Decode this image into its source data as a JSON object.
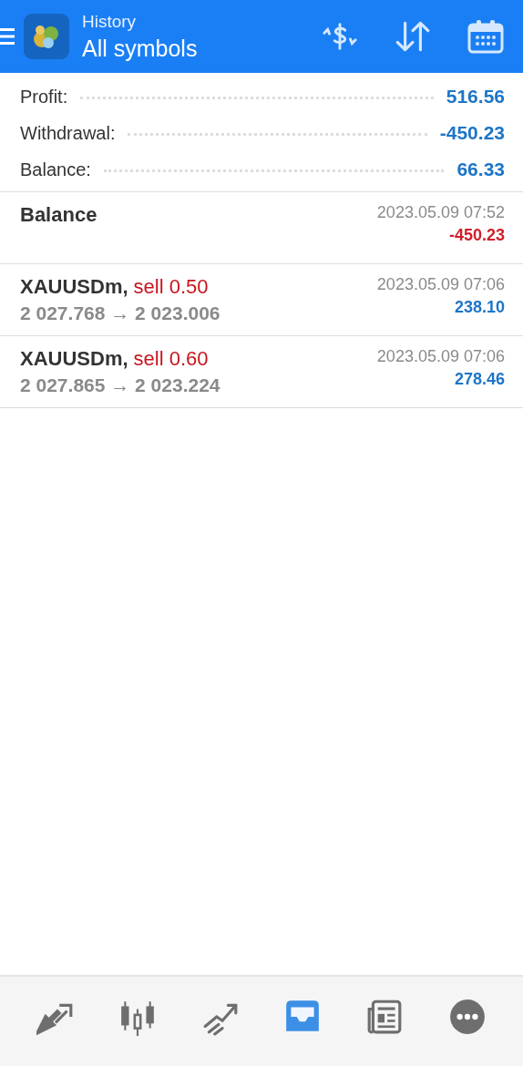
{
  "header": {
    "title": "History",
    "subtitle": "All symbols"
  },
  "summary": [
    {
      "label": "Profit:",
      "value": "516.56"
    },
    {
      "label": "Withdrawal:",
      "value": "-450.23"
    },
    {
      "label": "Balance:",
      "value": "66.33"
    }
  ],
  "deals": [
    {
      "kind": "balance",
      "title": "Balance",
      "time": "2023.05.09 07:52",
      "amount": "-450.23",
      "loss": true
    },
    {
      "kind": "trade",
      "symbol": "XAUUSDm,",
      "order": "sell 0.50",
      "prices": "2 027.768 → 2 023.006",
      "time": "2023.05.09 07:06",
      "amount": "238.10",
      "loss": false
    },
    {
      "kind": "trade",
      "symbol": "XAUUSDm,",
      "order": "sell 0.60",
      "prices": "2 027.865 → 2 023.224",
      "time": "2023.05.09 07:06",
      "amount": "278.46",
      "loss": false
    }
  ],
  "nav": [
    {
      "selected": false
    },
    {
      "selected": false
    },
    {
      "selected": false
    },
    {
      "selected": true
    },
    {
      "selected": false
    },
    {
      "selected": false
    }
  ]
}
